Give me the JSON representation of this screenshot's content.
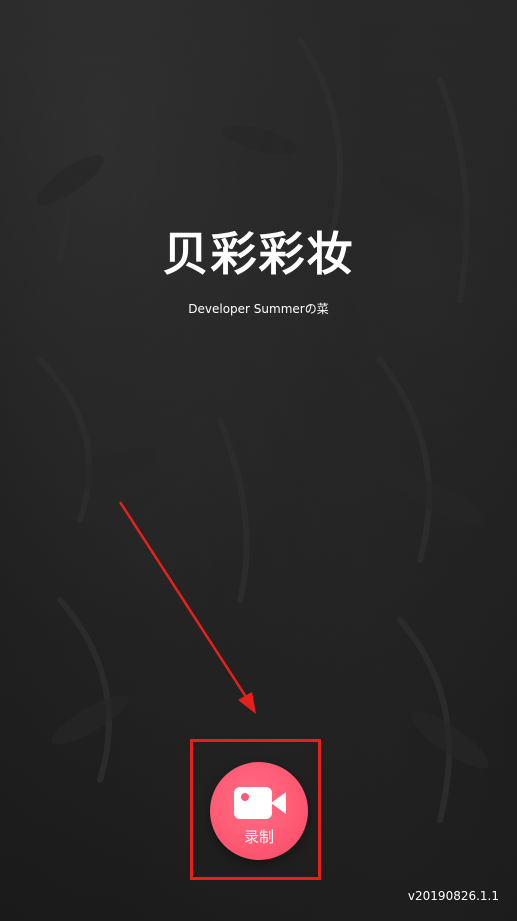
{
  "app": {
    "title": "贝彩彩妆",
    "subtitle": "Developer Summerの菜",
    "version": "v20190826.1.1"
  },
  "record": {
    "label": "录制",
    "icon": "video-camera-icon"
  },
  "annotation": {
    "arrow_icon": "red-arrow-icon",
    "highlight_color": "#e8201c"
  },
  "colors": {
    "background": "#1e1e1e",
    "button_accent": "#ff5a74",
    "text": "#ffffff"
  }
}
